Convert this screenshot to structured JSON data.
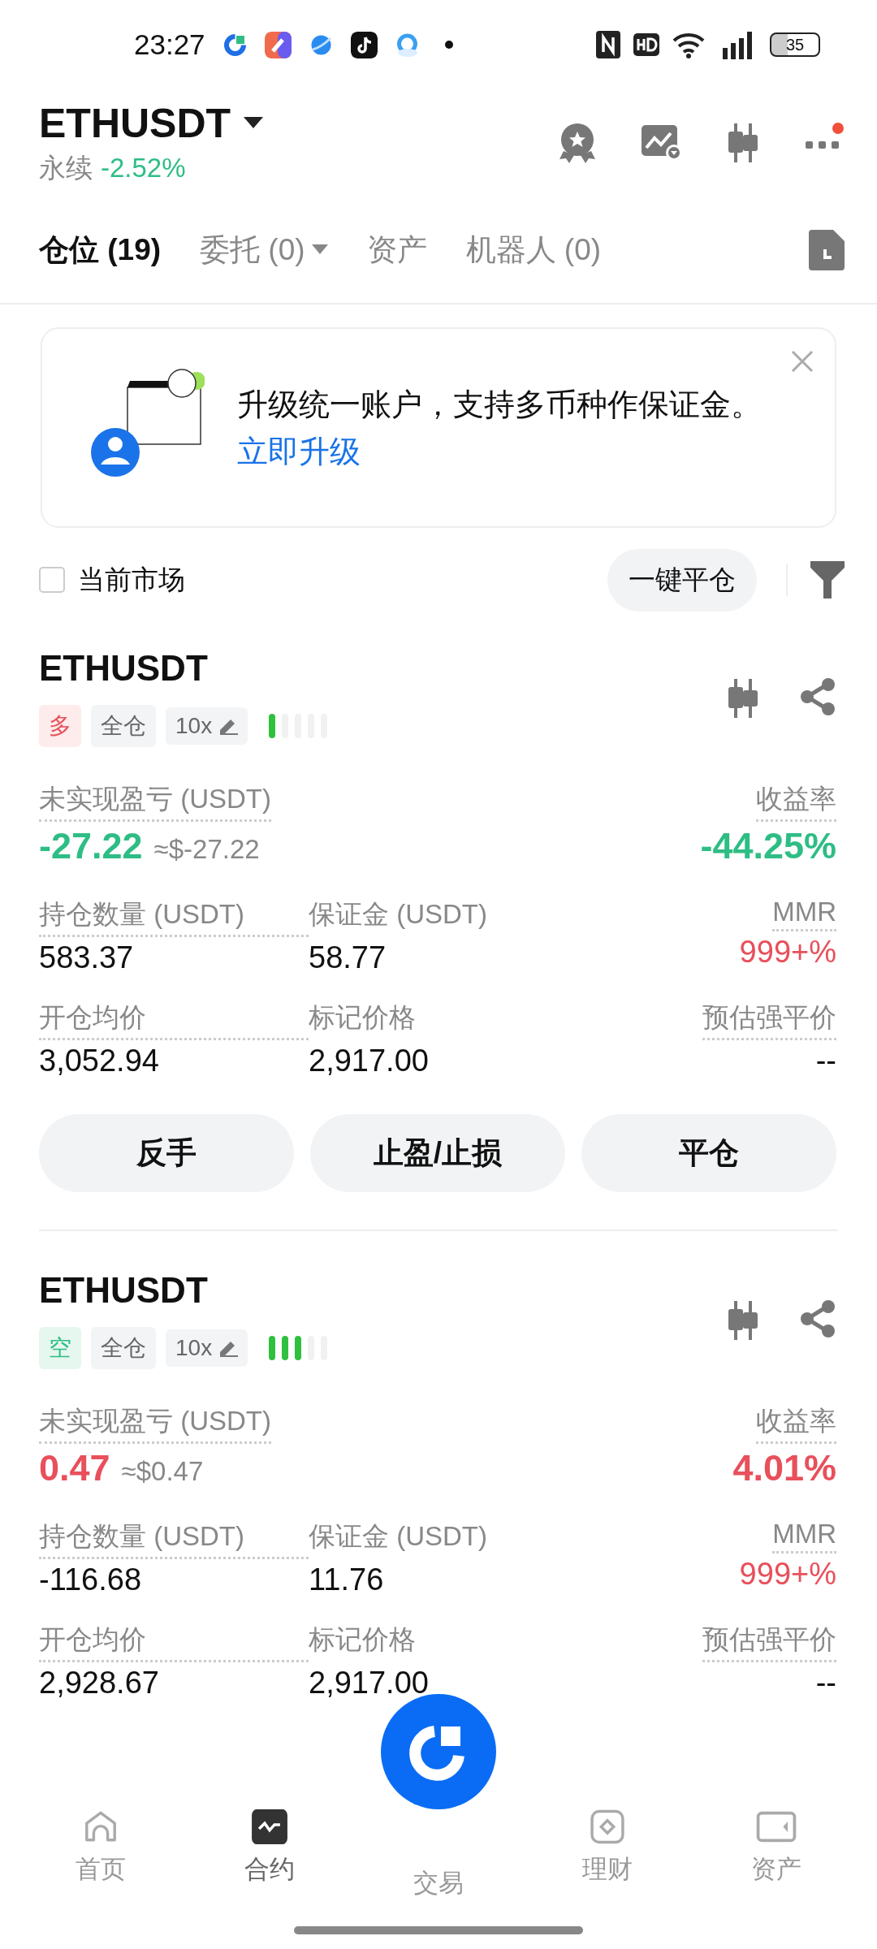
{
  "status_bar": {
    "time": "23:27",
    "battery": "35"
  },
  "header": {
    "symbol": "ETHUSDT",
    "type": "永续",
    "change": "-2.52%",
    "has_alert": true
  },
  "tabs": [
    {
      "label": "仓位 (19)",
      "selected": true,
      "dropdown": false
    },
    {
      "label": "委托 (0)",
      "selected": false,
      "dropdown": true
    },
    {
      "label": "资产",
      "selected": false,
      "dropdown": false
    },
    {
      "label": "机器人 (0)",
      "selected": false,
      "dropdown": false
    }
  ],
  "banner": {
    "text": "升级统一账户，支持多币种作保证金。",
    "link": "立即升级"
  },
  "filter": {
    "label": "当前市场",
    "checked": false,
    "button": "一键平仓"
  },
  "positions": [
    {
      "symbol": "ETHUSDT",
      "side": "多",
      "kind": "long",
      "margin_mode": "全仓",
      "leverage": "10x",
      "level": 0.2,
      "pnl_label": "未实现盈亏 (USDT)",
      "pnl": "-27.22",
      "pnl_usd": "≈$-27.22",
      "color": "#2ebd85",
      "roe_label": "收益率",
      "roe": "-44.25%",
      "fields": [
        {
          "label": "持仓数量 (USDT)",
          "value": "583.37",
          "hint": true,
          "color": "#111111"
        },
        {
          "label": "保证金 (USDT)",
          "value": "58.77",
          "hint": false,
          "color": "#111111"
        },
        {
          "label": "MMR",
          "value": "999+%",
          "hint": true,
          "color": "#e8505b"
        },
        {
          "label": "开仓均价",
          "value": "3,052.94",
          "hint": true,
          "color": "#111111"
        },
        {
          "label": "标记价格",
          "value": "2,917.00",
          "hint": false,
          "color": "#111111"
        },
        {
          "label": "预估强平价",
          "value": "--",
          "hint": true,
          "color": "#111111"
        }
      ],
      "buttons": [
        "反手",
        "止盈/止损",
        "平仓"
      ]
    },
    {
      "symbol": "ETHUSDT",
      "side": "空",
      "kind": "short",
      "margin_mode": "全仓",
      "leverage": "10x",
      "level": 0.6,
      "pnl_label": "未实现盈亏 (USDT)",
      "pnl": "0.47",
      "pnl_usd": "≈$0.47",
      "color": "#e8505b",
      "roe_label": "收益率",
      "roe": "4.01%",
      "fields": [
        {
          "label": "持仓数量 (USDT)",
          "value": "-116.68",
          "hint": true,
          "color": "#111111"
        },
        {
          "label": "保证金 (USDT)",
          "value": "11.76",
          "hint": false,
          "color": "#111111"
        },
        {
          "label": "MMR",
          "value": "999+%",
          "hint": true,
          "color": "#e8505b"
        },
        {
          "label": "开仓均价",
          "value": "2,928.67",
          "hint": true,
          "color": "#111111"
        },
        {
          "label": "标记价格",
          "value": "2,917.00",
          "hint": false,
          "color": "#111111"
        },
        {
          "label": "预估强平价",
          "value": "--",
          "hint": true,
          "color": "#111111"
        }
      ]
    }
  ],
  "nav": [
    {
      "label": "首页",
      "kind": "home",
      "selected": false
    },
    {
      "label": "合约",
      "kind": "futures",
      "selected": true
    },
    {
      "label": "交易",
      "kind": "trade",
      "selected": false
    },
    {
      "label": "理财",
      "kind": "earn",
      "selected": false
    },
    {
      "label": "资产",
      "kind": "assets",
      "selected": false
    }
  ]
}
